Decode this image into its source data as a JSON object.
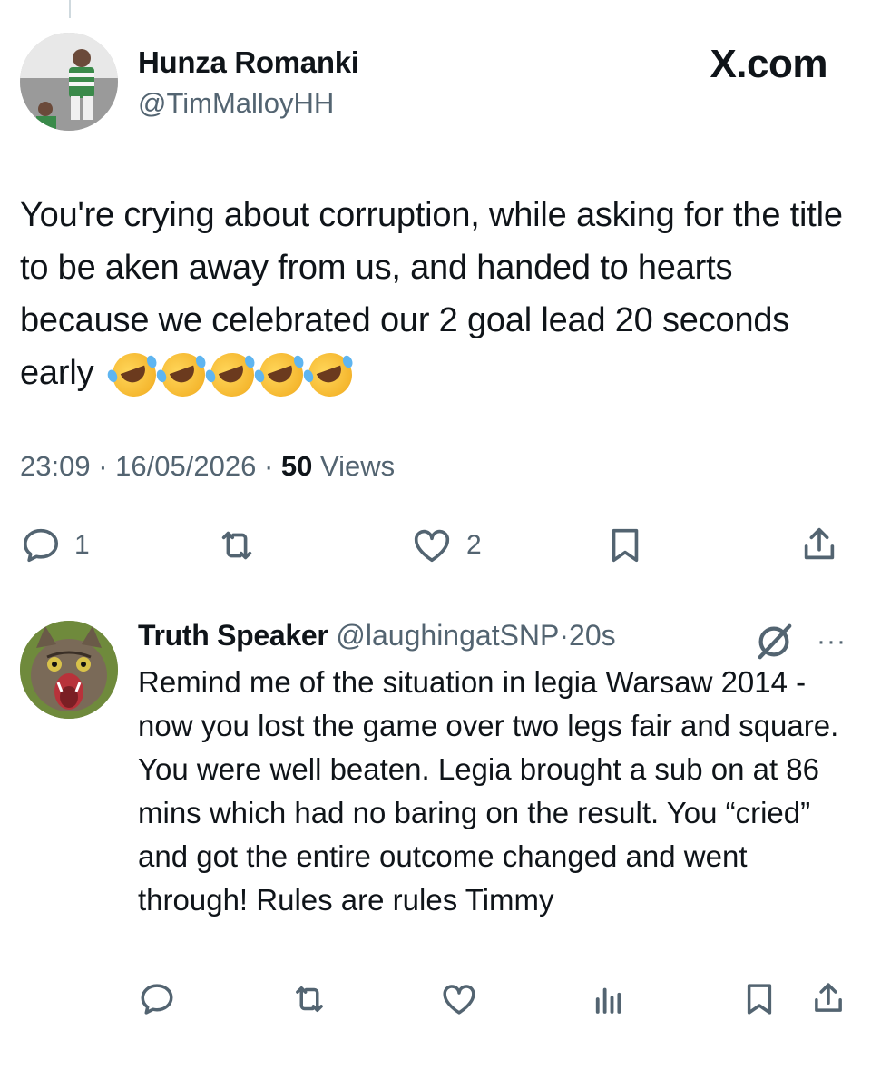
{
  "brand": "X.com",
  "main_tweet": {
    "author_name": "Hunza Romanki",
    "author_handle": "@TimMalloyHH",
    "text": "You're crying about corruption, while asking for the title to be aken away from us, and handed to hearts because we celebrated our 2 goal lead 20 seconds early",
    "emoji": [
      "🤣",
      "🤣",
      "🤣",
      "🤣",
      "🤣"
    ],
    "time": "23:09",
    "date": "16/05/2026",
    "views_count": "50",
    "views_label": "Views",
    "separator": "·",
    "replies_count": "1",
    "likes_count": "2"
  },
  "reply_tweet": {
    "author_name": "Truth Speaker",
    "author_handle": "@laughingatSNP",
    "time_ago": "20s",
    "separator": "·",
    "more_label": "···",
    "text": "Remind me of the situation in legia Warsaw 2014 - now you lost the game over two legs fair and square. You were well beaten. Legia brought a sub on at 86 mins which had no baring on the result. You “cried” and got the entire outcome changed and went through! Rules are rules Timmy"
  },
  "icons": {
    "reply": "reply-icon",
    "retweet": "retweet-icon",
    "like": "heart-icon",
    "bookmark": "bookmark-icon",
    "share": "share-icon",
    "views": "views-icon",
    "grok": "grok-icon",
    "more": "more-icon"
  },
  "colors": {
    "text": "#0f1419",
    "secondary": "#536471",
    "divider": "#e1e8ed"
  }
}
